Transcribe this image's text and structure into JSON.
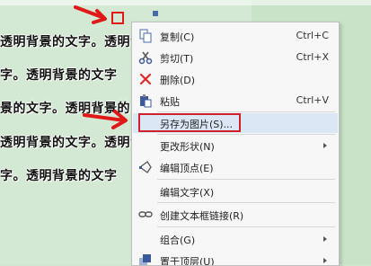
{
  "document": {
    "lines": [
      "透明背景的文字。透明背",
      "字。透明背景的文字",
      "景的文字。透明背景的",
      "透明背景的文字。透明背",
      "字。透明背景的文字"
    ]
  },
  "context_menu": {
    "items": [
      {
        "label": "复制(C)",
        "shortcut": "Ctrl+C",
        "icon": "copy-icon"
      },
      {
        "label": "剪切(T)",
        "shortcut": "Ctrl+X",
        "icon": "scissors-icon"
      },
      {
        "label": "删除(D)",
        "shortcut": "",
        "icon": "delete-x-icon"
      },
      {
        "label": "粘贴",
        "shortcut": "Ctrl+V",
        "icon": "paste-icon"
      },
      {
        "label": "另存为图片(S)...",
        "shortcut": "",
        "icon": ""
      },
      {
        "label": "更改形状(N)",
        "shortcut": "",
        "icon": ""
      },
      {
        "label": "编辑顶点(E)",
        "shortcut": "",
        "icon": "edit-points-icon"
      },
      {
        "label": "编辑文字(X)",
        "shortcut": "",
        "icon": ""
      },
      {
        "label": "创建文本框链接(R)",
        "shortcut": "",
        "icon": "link-icon"
      },
      {
        "label": "组合(G)",
        "shortcut": "",
        "icon": ""
      },
      {
        "label": "置于顶层(U)",
        "shortcut": "",
        "icon": "bring-to-front-icon"
      }
    ],
    "highlighted_index": 4
  },
  "colors": {
    "annotation_red": "#e01818",
    "menu_highlight": "#dbe7f5",
    "document_bg": "#d3e9d3"
  }
}
